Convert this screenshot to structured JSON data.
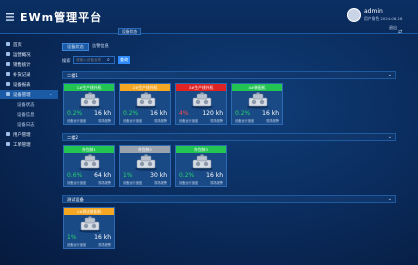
{
  "app": {
    "title": "EWm管理平台",
    "brand_color": "#0a2a5a",
    "accent": "#2f8bff"
  },
  "user": {
    "name": "admin",
    "info": "用户角色 2024-06-18",
    "exit_label": "退出"
  },
  "top_tab": {
    "label": "设备状态"
  },
  "sidebar": {
    "items": [
      {
        "label": "首页",
        "icon": "home-icon"
      },
      {
        "label": "运营概况",
        "icon": "chart-icon"
      },
      {
        "label": "销售统计",
        "icon": "bar-icon"
      },
      {
        "label": "补货记录",
        "icon": "box-icon"
      },
      {
        "label": "设备报表",
        "icon": "report-icon"
      },
      {
        "label": "设备管理",
        "icon": "device-icon"
      }
    ],
    "sub_items": [
      {
        "label": "设备状态"
      },
      {
        "label": "设备信息"
      },
      {
        "label": "设备日志"
      }
    ],
    "tail_items": [
      {
        "label": "用户管理",
        "icon": "user-icon"
      },
      {
        "label": "工单管理",
        "icon": "ticket-icon"
      }
    ]
  },
  "subtabs": [
    {
      "label": "设备状态"
    },
    {
      "label": "告警信息"
    }
  ],
  "search": {
    "label": "搜索",
    "placeholder": "请输入设备名称",
    "button_label": "查询"
  },
  "groups": [
    {
      "title": "二楼1",
      "cards": [
        {
          "name": "1#生产线外机",
          "status_color": "#23c552",
          "percent": "0.2%",
          "speed": "16 kh",
          "left_label": "设备运行速度",
          "right_label": "现场报警",
          "percent_color": "green"
        },
        {
          "name": "2#生产线外机",
          "status_color": "#f5a623",
          "percent": "0.2%",
          "speed": "16 kh",
          "left_label": "设备运行速度",
          "right_label": "现场报警",
          "percent_color": "green"
        },
        {
          "name": "3#生产线外机",
          "status_color": "#e02424",
          "percent": "4%",
          "speed": "120 kh",
          "left_label": "设备运行速度",
          "right_label": "现场报警",
          "percent_color": "red"
        },
        {
          "name": "4#装配机",
          "status_color": "#23c552",
          "percent": "0.2%",
          "speed": "16 kh",
          "left_label": "设备运行速度",
          "right_label": "现场报警",
          "percent_color": "green"
        }
      ]
    },
    {
      "title": "二楼2",
      "cards": [
        {
          "name": "外包装1",
          "status_color": "#23c552",
          "percent": "0.6%",
          "speed": "64 kh",
          "left_label": "设备运行速度",
          "right_label": "现场报警",
          "percent_color": "green"
        },
        {
          "name": "外包装2",
          "status_color": "#9aa3ad",
          "percent": "1%",
          "speed": "30 kh",
          "left_label": "设备运行速度",
          "right_label": "现场报警",
          "percent_color": "green"
        },
        {
          "name": "外包装3",
          "status_color": "#23c552",
          "percent": "0.2%",
          "speed": "16 kh",
          "left_label": "设备运行速度",
          "right_label": "现场报警",
          "percent_color": "green"
        }
      ]
    },
    {
      "title": "测试设备",
      "cards": [
        {
          "name": "1#测试装配机",
          "status_color": "#f5a623",
          "percent": "1%",
          "speed": "16 kh",
          "left_label": "设备运行速度",
          "right_label": "现场报警",
          "percent_color": "green"
        }
      ]
    }
  ]
}
